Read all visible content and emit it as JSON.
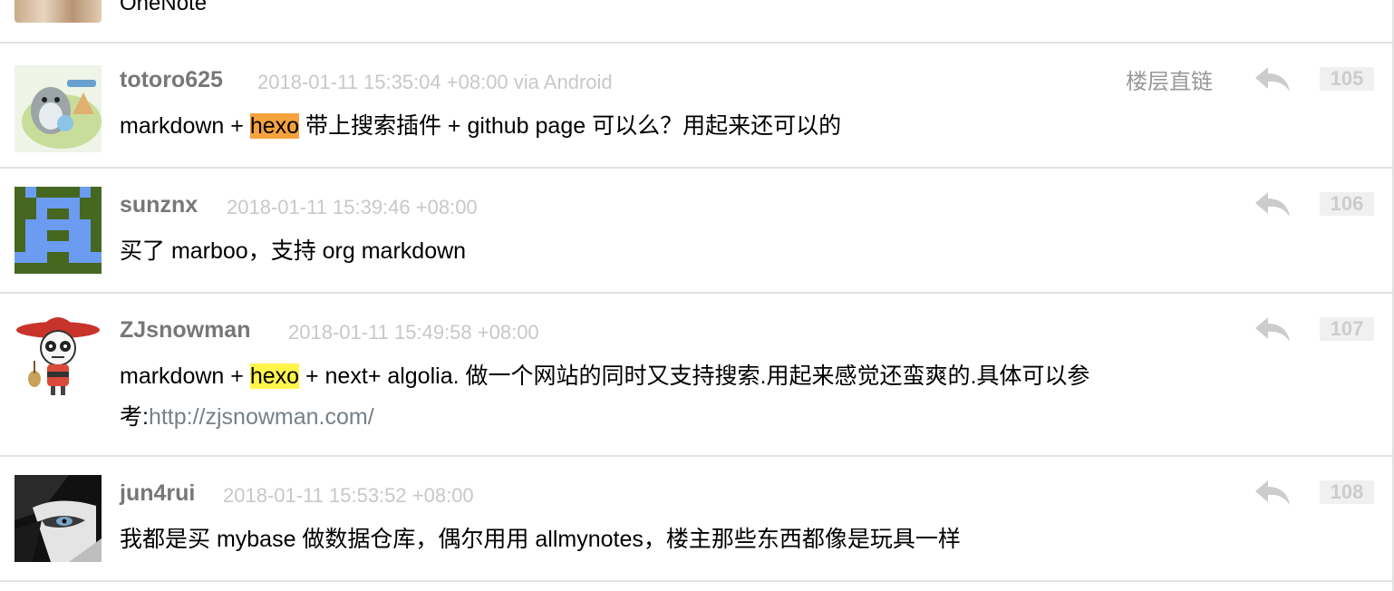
{
  "top": {
    "text": "OneNote"
  },
  "floor_link_label": "楼层直链",
  "replies": [
    {
      "author": "totoro625",
      "meta": "2018-01-11 15:35:04 +08:00 via Android",
      "pre": "markdown + ",
      "highlight": "hexo",
      "post": " 带上搜索插件 + github page 可以么？用起来还可以的",
      "num": "105"
    },
    {
      "author": "sunznx",
      "meta": "2018-01-11 15:39:46 +08:00",
      "content": "买了 marboo，支持 org markdown",
      "num": "106"
    },
    {
      "author": "ZJsnowman",
      "meta": "2018-01-11 15:49:58 +08:00",
      "pre": "markdown + ",
      "highlight": "hexo",
      "post": " + next+ algolia. 做一个网站的同时又支持搜索.用起来感觉还蛮爽的.具体可以参考:",
      "link": "http://zjsnowman.com/",
      "num": "107"
    },
    {
      "author": "jun4rui",
      "meta": "2018-01-11 15:53:52 +08:00",
      "content": "我都是买 mybase 做数据仓库，偶尔用用 allmynotes，楼主那些东西都像是玩具一样",
      "num": "108"
    }
  ],
  "colors": {
    "highlight_orange": "#f6a23d",
    "highlight_yellow": "#fff54a",
    "author": "#777777",
    "meta": "#c8c8c8",
    "link": "#778087"
  }
}
